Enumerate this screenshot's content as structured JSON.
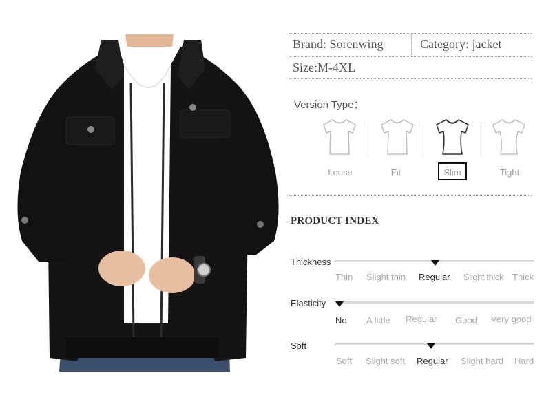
{
  "specs": {
    "brand": "Brand: Sorenwing",
    "category": "Category: jacket",
    "size_label": "Size:",
    "size_value": "M-4XL"
  },
  "version": {
    "title": "Version Type：",
    "options": [
      "Loose",
      "Fit",
      "Slim",
      "Tight"
    ],
    "selected": "Slim"
  },
  "product_index": {
    "title": "PRODUCT INDEX",
    "scales": [
      {
        "name": "Thickness",
        "options": [
          "Thin",
          "Slight thin",
          "Regular",
          "Slight thick",
          "Thick"
        ],
        "selected": "Regular"
      },
      {
        "name": "Elasticity",
        "options": [
          "No",
          "A little",
          "Regular",
          "Good",
          "Very good"
        ],
        "selected": "No"
      },
      {
        "name": "Soft",
        "options": [
          "Soft",
          "Slight soft",
          "Regular",
          "Slight hard",
          "Hard"
        ],
        "selected": "Regular"
      }
    ]
  },
  "colors": {
    "jacket": "#141414",
    "shirt": "#ffffff",
    "jeans": "#3c4f6b",
    "skin": "#e7c0a2",
    "selected_border": "#111111"
  }
}
